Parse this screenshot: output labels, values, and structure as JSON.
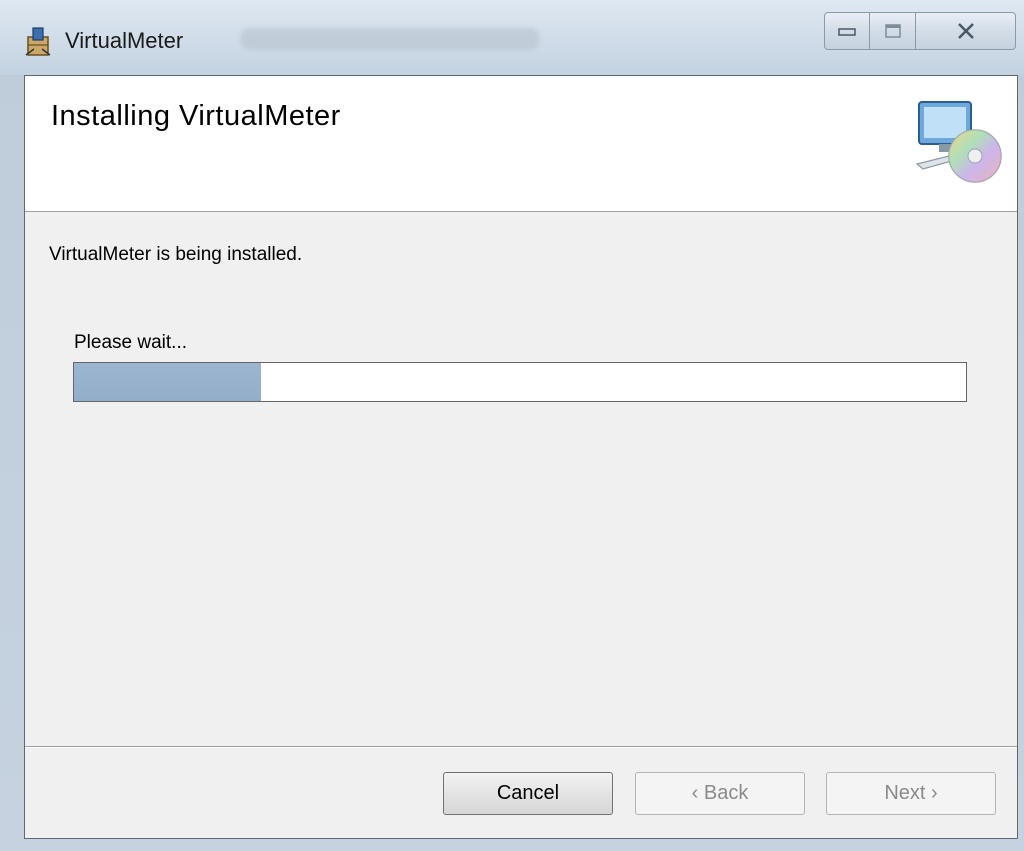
{
  "window": {
    "title": "VirtualMeter",
    "icons": {
      "app": "installer-package-icon",
      "minimize": "minimize-icon",
      "maximize": "maximize-icon",
      "close": "close-icon"
    }
  },
  "banner": {
    "title": "Installing VirtualMeter",
    "icon": "computer-with-disc-icon"
  },
  "body": {
    "status": "VirtualMeter is being installed.",
    "wait_label": "Please wait...",
    "progress_percent": 21
  },
  "buttons": {
    "cancel": "Cancel",
    "back": "‹ Back",
    "next": "Next ›"
  },
  "colors": {
    "progress_fill": "#9db5d0",
    "disabled_text": "#8a8a8a"
  }
}
